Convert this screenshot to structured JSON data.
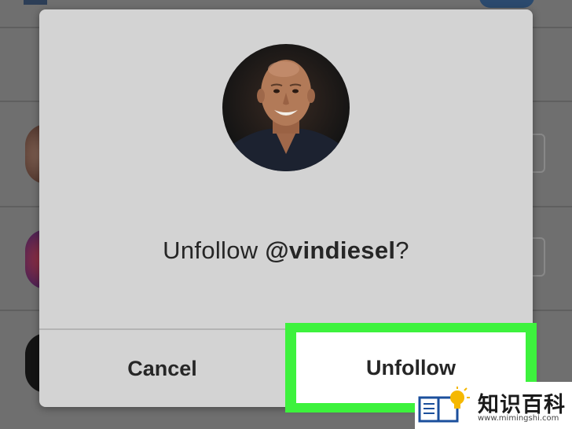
{
  "dialog": {
    "prompt_prefix": "Unfollow ",
    "prompt_handle": "@vindiesel",
    "prompt_suffix": "?",
    "cancel_label": "Cancel",
    "unfollow_label": "Unfollow"
  },
  "watermark": {
    "brand": "知识百科",
    "url": "www.mimingshi.com"
  },
  "colors": {
    "dialog_bg": "#d3d3d3",
    "highlight": "#3df23d",
    "text": "#262626",
    "overlay": "#6f6f6f"
  },
  "icons": [
    "profile-photo",
    "book-icon",
    "lightbulb-icon"
  ]
}
